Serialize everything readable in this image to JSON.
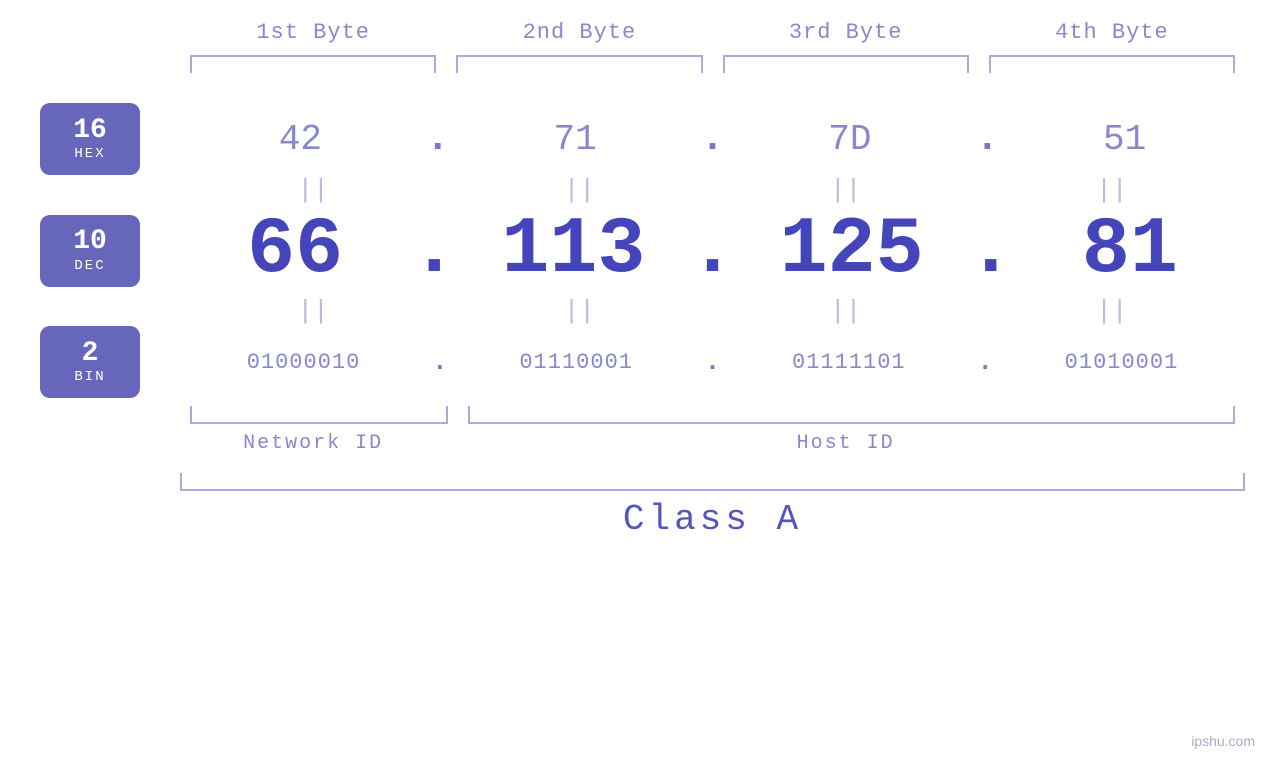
{
  "headers": {
    "byte1": "1st Byte",
    "byte2": "2nd Byte",
    "byte3": "3rd Byte",
    "byte4": "4th Byte"
  },
  "bases": {
    "hex": {
      "num": "16",
      "label": "HEX"
    },
    "dec": {
      "num": "10",
      "label": "DEC"
    },
    "bin": {
      "num": "2",
      "label": "BIN"
    }
  },
  "values": {
    "hex": [
      "42",
      "71",
      "7D",
      "51"
    ],
    "dec": [
      "66",
      "113",
      "125",
      "81"
    ],
    "bin": [
      "01000010",
      "01110001",
      "01111101",
      "01010001"
    ]
  },
  "labels": {
    "network_id": "Network ID",
    "host_id": "Host ID",
    "class": "Class A"
  },
  "watermark": "ipshu.com",
  "dots": [
    ".",
    ".",
    ".",
    ""
  ],
  "equals": [
    "||",
    "||",
    "||",
    "||"
  ]
}
